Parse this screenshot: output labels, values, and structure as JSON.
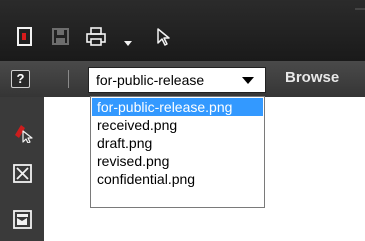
{
  "toolbar": {
    "icons": [
      "new-document-icon",
      "save-icon",
      "print-icon",
      "chevron-down-icon",
      "pointer-icon"
    ]
  },
  "secondbar": {
    "help_label": "?",
    "selected_stamp": "for-public-release",
    "browse_label": "Browse"
  },
  "dropdown": {
    "options": [
      "for-public-release.png",
      "received.png",
      "draft.png",
      "revised.png",
      "confidential.png"
    ],
    "selected_index": 0
  },
  "sidebar": {
    "icons": [
      "stamp-tool-icon",
      "checkbox-x-icon",
      "form-field-icon"
    ]
  },
  "colors": {
    "selection": "#3399ff",
    "toolbar_bg": "#1f1f1f",
    "secondbar_bg": "#404040",
    "accent_red": "#cc1d1d"
  }
}
